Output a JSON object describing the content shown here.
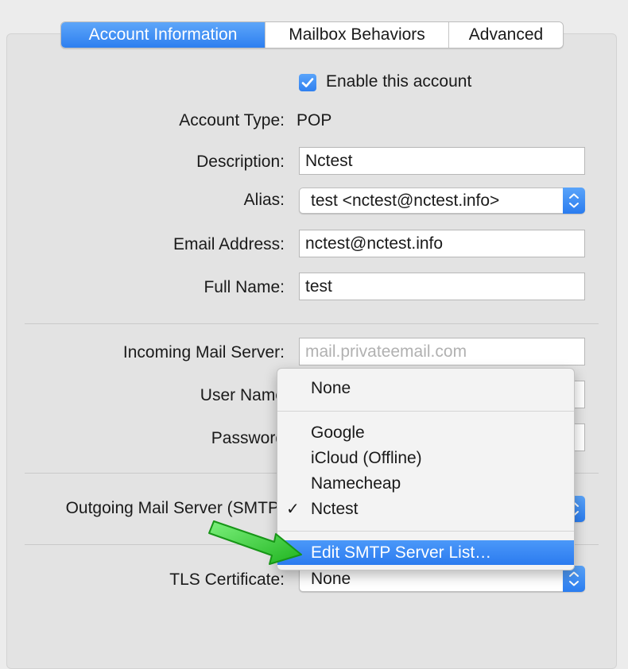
{
  "tabs": [
    {
      "label": "Account Information",
      "active": true
    },
    {
      "label": "Mailbox Behaviors",
      "active": false
    },
    {
      "label": "Advanced",
      "active": false
    }
  ],
  "enable_account": {
    "label": "Enable this account",
    "checked": true
  },
  "account_type": {
    "label": "Account Type:",
    "value": "POP"
  },
  "description": {
    "label": "Description:",
    "value": "Nctest"
  },
  "alias": {
    "label": "Alias:",
    "value": "test <nctest@nctest.info>"
  },
  "email_address": {
    "label": "Email Address:",
    "value": "nctest@nctest.info"
  },
  "full_name": {
    "label": "Full Name:",
    "value": "test"
  },
  "incoming_server": {
    "label": "Incoming Mail Server:",
    "placeholder": "mail.privateemail.com"
  },
  "user_name": {
    "label": "User Name"
  },
  "password": {
    "label": "Password"
  },
  "outgoing_server": {
    "label": "Outgoing Mail Server (SMTP)"
  },
  "tls_certificate": {
    "label": "TLS Certificate:",
    "value": "None"
  },
  "smtp_menu": {
    "items": [
      "None",
      "Google",
      "iCloud (Offline)",
      "Namecheap",
      "Nctest",
      "Edit SMTP Server List…"
    ],
    "checked_item": "Nctest",
    "checkmark": "✓",
    "highlighted_item": "Edit SMTP Server List…"
  },
  "colors": {
    "accent_blue": "#2d7ff0",
    "arrow_green": "#33cc33",
    "background": "#e3e3e3"
  }
}
